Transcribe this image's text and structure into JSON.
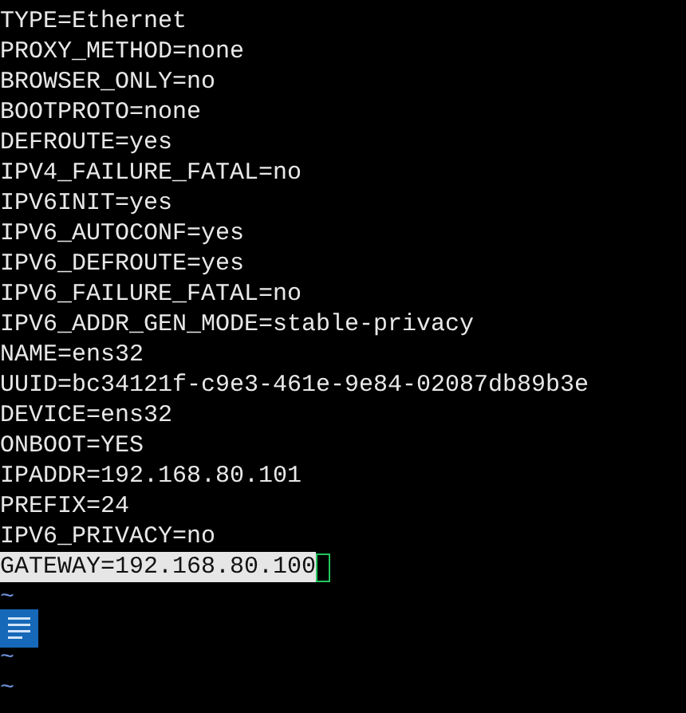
{
  "editor": {
    "lines": [
      {
        "text": "TYPE=Ethernet",
        "selected": false,
        "cursor": false
      },
      {
        "text": "PROXY_METHOD=none",
        "selected": false,
        "cursor": false
      },
      {
        "text": "BROWSER_ONLY=no",
        "selected": false,
        "cursor": false
      },
      {
        "text": "BOOTPROTO=none",
        "selected": false,
        "cursor": false
      },
      {
        "text": "DEFROUTE=yes",
        "selected": false,
        "cursor": false
      },
      {
        "text": "IPV4_FAILURE_FATAL=no",
        "selected": false,
        "cursor": false
      },
      {
        "text": "IPV6INIT=yes",
        "selected": false,
        "cursor": false
      },
      {
        "text": "IPV6_AUTOCONF=yes",
        "selected": false,
        "cursor": false
      },
      {
        "text": "IPV6_DEFROUTE=yes",
        "selected": false,
        "cursor": false
      },
      {
        "text": "IPV6_FAILURE_FATAL=no",
        "selected": false,
        "cursor": false
      },
      {
        "text": "IPV6_ADDR_GEN_MODE=stable-privacy",
        "selected": false,
        "cursor": false
      },
      {
        "text": "NAME=ens32",
        "selected": false,
        "cursor": false
      },
      {
        "text": "UUID=bc34121f-c9e3-461e-9e84-02087db89b3e",
        "selected": false,
        "cursor": false
      },
      {
        "text": "DEVICE=ens32",
        "selected": false,
        "cursor": false
      },
      {
        "text": "ONBOOT=YES",
        "selected": false,
        "cursor": false
      },
      {
        "text": "IPADDR=192.168.80.101",
        "selected": false,
        "cursor": false
      },
      {
        "text": "PREFIX=24",
        "selected": false,
        "cursor": false
      },
      {
        "text": "IPV6_PRIVACY=no",
        "selected": false,
        "cursor": false
      },
      {
        "text": "GATEWAY=192.168.80.100",
        "selected": true,
        "cursor": true
      }
    ],
    "filler_rows": [
      {
        "kind": "tilde",
        "text": "~"
      },
      {
        "kind": "icon"
      },
      {
        "kind": "tilde",
        "text": "~"
      },
      {
        "kind": "tilde",
        "text": "~"
      }
    ]
  }
}
